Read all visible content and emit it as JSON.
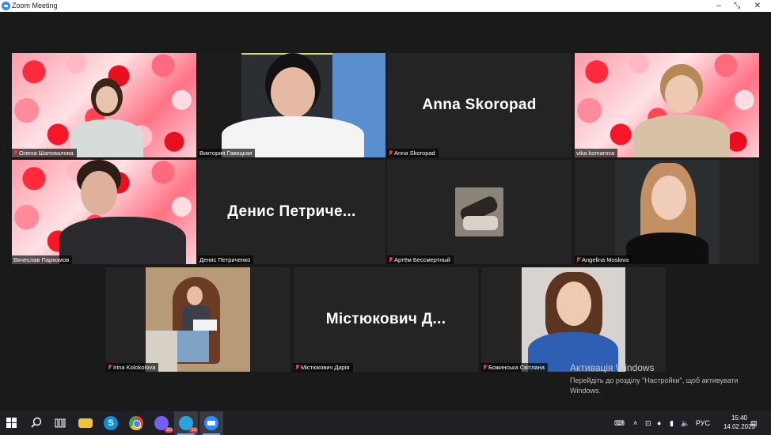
{
  "window": {
    "title": "Zoom Meeting",
    "minimize": "–",
    "restore": "⤡",
    "close": "✕"
  },
  "participants": [
    {
      "name": "Олена Шаповалова",
      "video": "on",
      "muted": true,
      "background": "hearts"
    },
    {
      "name": "Виктория Гавацкая",
      "video": "on",
      "muted": false,
      "active_speaker": true
    },
    {
      "name": "Anna Skoropad",
      "video": "off",
      "muted": true,
      "display_name": "Anna Skoropad"
    },
    {
      "name": "vika komarova",
      "video": "on",
      "muted": false,
      "background": "hearts"
    },
    {
      "name": "Вячеслав Пархомов",
      "video": "on",
      "muted": false,
      "background": "hearts"
    },
    {
      "name": "Денис Петриченко",
      "video": "off",
      "muted": false,
      "display_name": "Денис  Петриче..."
    },
    {
      "name": "Артём Бессмертный",
      "video": "avatar",
      "muted": true
    },
    {
      "name": "Angelina Moslova",
      "video": "on",
      "muted": true
    },
    {
      "name": "Irina Kolokolova",
      "video": "on",
      "muted": true
    },
    {
      "name": "Містюкович Дарія",
      "video": "off",
      "muted": true,
      "display_name": "Містюкович  Д..."
    },
    {
      "name": "Божинська Світлана",
      "video": "on",
      "muted": true
    }
  ],
  "activation": {
    "title": "Активація Windows",
    "message": "Перейдіть до розділу \"Настройки\", щоб активувати Windows."
  },
  "taskbar": {
    "apps": [
      "search-icon",
      "task-view-icon",
      "file-explorer-icon",
      "skype-icon",
      "chrome-icon",
      "viber-icon",
      "telegram-icon",
      "zoom-icon"
    ],
    "badges": {
      "viber": "20",
      "telegram": "10"
    },
    "language": "РУС",
    "time": "15:40",
    "date": "14.02.2023",
    "colors": {
      "accent": "#2d8cff",
      "active_border": "#d7e35c",
      "muted_mic": "#e0443e"
    }
  }
}
